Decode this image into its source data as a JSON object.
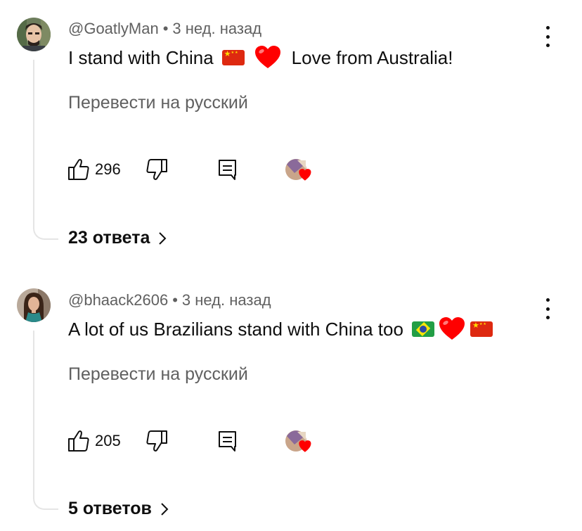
{
  "comments": [
    {
      "author": "@GoatlyMan",
      "age": "3 нед. назад",
      "text_before": "I stand with China",
      "text_after": "Love from Australia!",
      "translate": "Перевести на русский",
      "likes": "296",
      "replies": "23 ответа"
    },
    {
      "author": "@bhaack2606",
      "age": "3 нед. назад",
      "text_before": "A lot of us Brazilians stand with China too",
      "translate": "Перевести на русский",
      "likes": "205",
      "replies": "5 ответов"
    }
  ],
  "icons": {
    "like": "thumb-up-icon",
    "dislike": "thumb-down-icon",
    "reply": "reply-icon",
    "more": "more-vert-icon",
    "creator_heart": "creator-heart-icon",
    "chevron": "chevron-right-icon"
  },
  "colors": {
    "text": "#0f0f0f",
    "secondary": "#606060",
    "heart": "#ff0000",
    "thread": "#e5e5e5"
  }
}
